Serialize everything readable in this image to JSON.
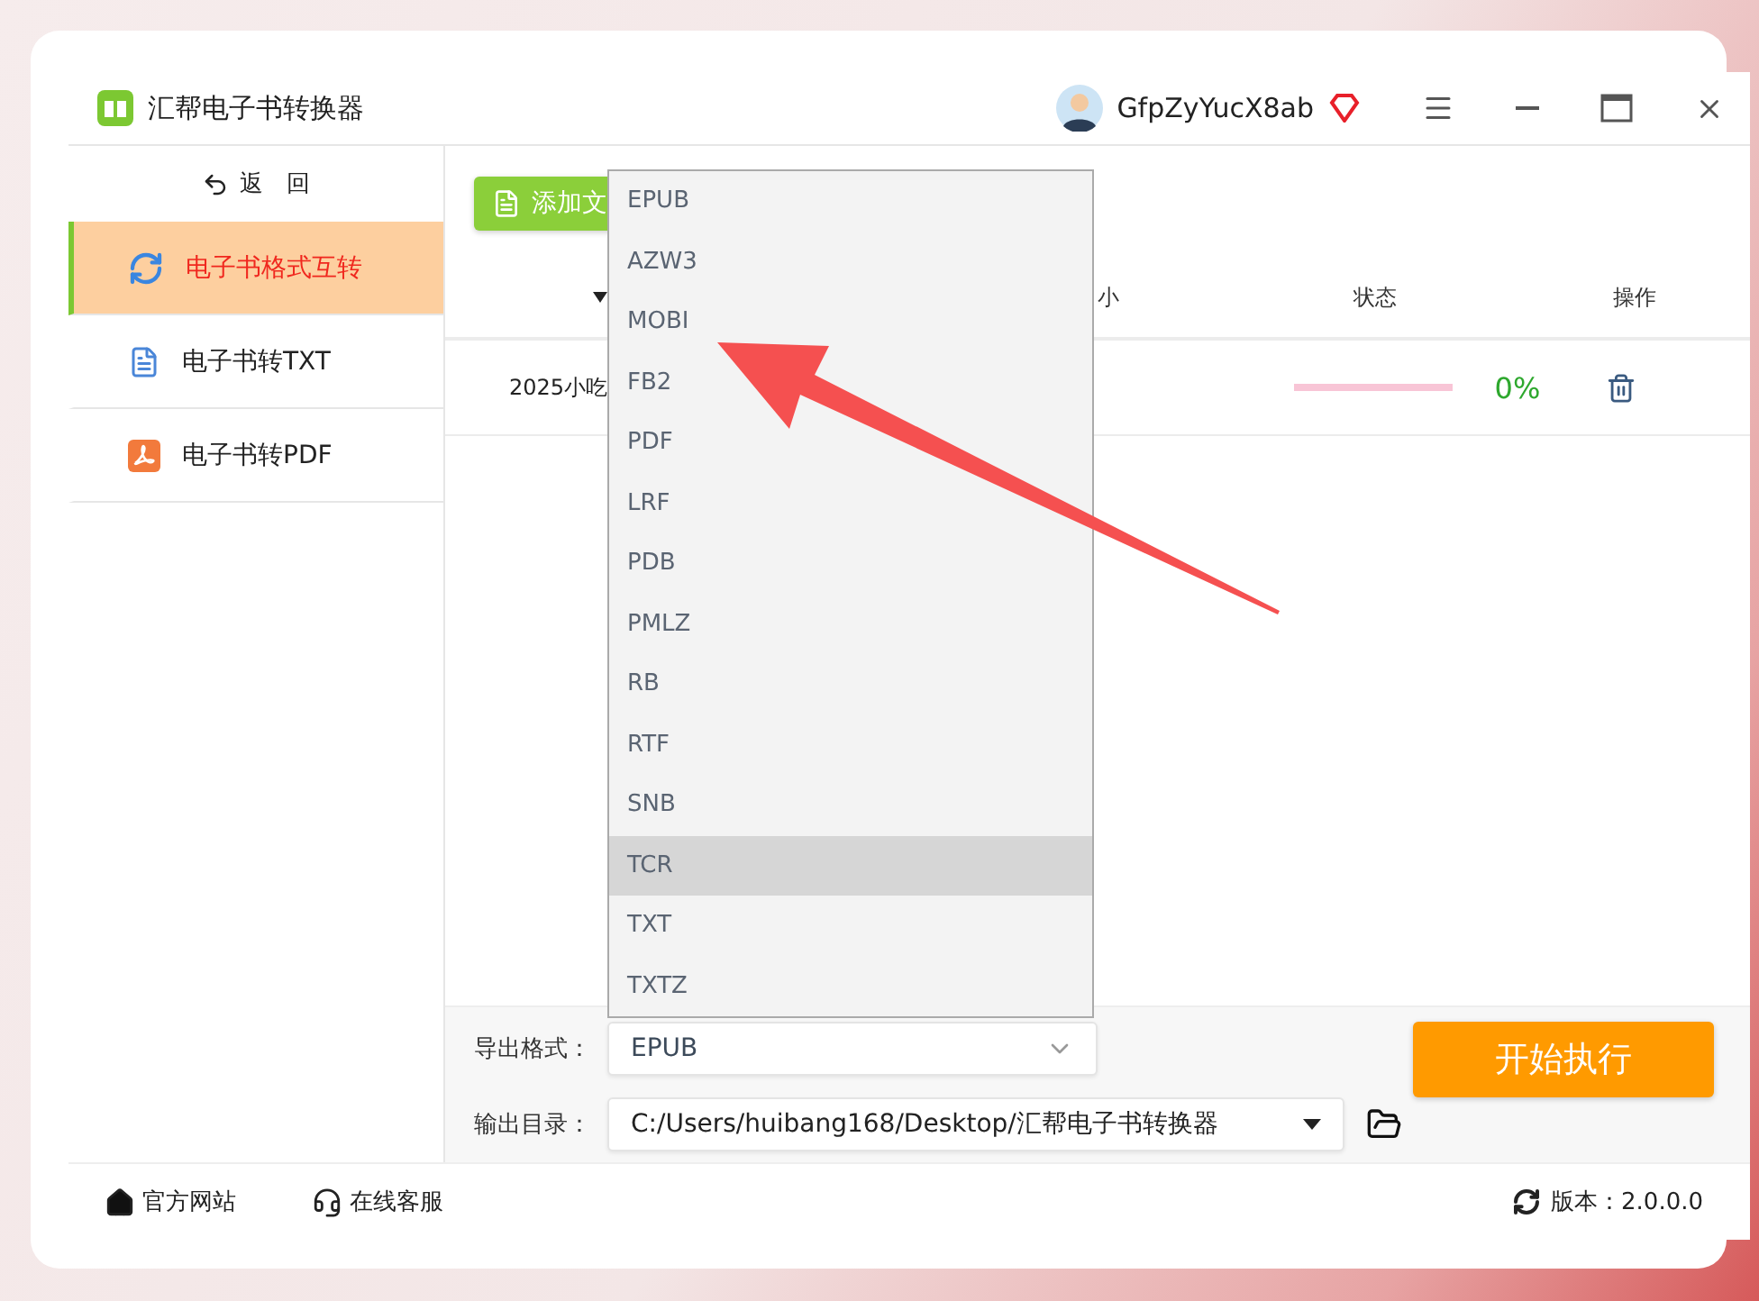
{
  "app": {
    "title": "汇帮电子书转换器",
    "user": "GfpZyYucX8ab"
  },
  "back": "返　回",
  "sidebar": [
    {
      "label": "电子书格式互转",
      "selected": true
    },
    {
      "label": "电子书转TXT",
      "selected": false
    },
    {
      "label": "电子书转PDF",
      "selected": false
    }
  ],
  "toolbar": {
    "add_button": "添加文"
  },
  "table": {
    "columns": [
      "小",
      "状态",
      "操作"
    ],
    "rows": [
      {
        "name": "2025小吃",
        "level": 0,
        "percent": "0%"
      }
    ]
  },
  "dropdown": {
    "options": [
      {
        "label": "EPUB",
        "selected": false
      },
      {
        "label": "AZW3",
        "selected": false
      },
      {
        "label": "MOBI",
        "selected": false
      },
      {
        "label": "FB2",
        "selected": false
      },
      {
        "label": "PDF",
        "selected": false
      },
      {
        "label": "LRF",
        "selected": false
      },
      {
        "label": "PDB",
        "selected": false
      },
      {
        "label": "PMLZ",
        "selected": false
      },
      {
        "label": "RB",
        "selected": false
      },
      {
        "label": "RTF",
        "selected": false
      },
      {
        "label": "SNB",
        "selected": false
      },
      {
        "label": "TCR",
        "selected": true
      },
      {
        "label": "TXT",
        "selected": false
      },
      {
        "label": "TXTZ",
        "selected": false
      }
    ]
  },
  "export": {
    "format_label": "导出格式：",
    "format_value": "EPUB",
    "dir_label": "输出目录：",
    "dir_value": "C:/Users/huibang168/Desktop/汇帮电子书转换器",
    "start_button": "开始执行"
  },
  "footer": {
    "website": "官方网站",
    "support": "在线客服",
    "version": "版本：2.0.0.0"
  }
}
